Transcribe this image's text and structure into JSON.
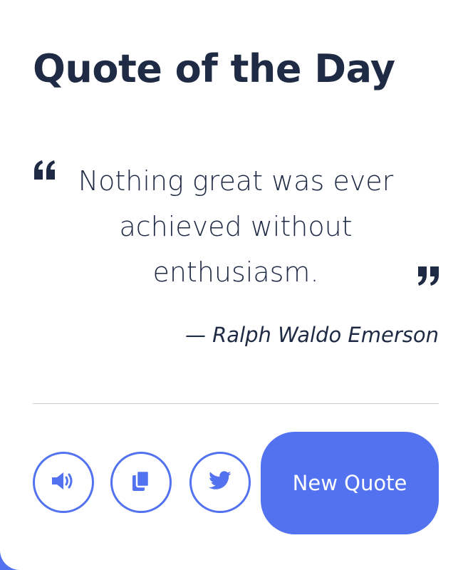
{
  "header": {
    "title": "Quote of the Day"
  },
  "quote": {
    "text": "Nothing great was ever achieved without enthusiasm.",
    "author": "— Ralph Waldo Emerson",
    "open_mark_icon": "quote-left-icon",
    "close_mark_icon": "quote-right-icon"
  },
  "actions": {
    "speech_icon": "volume-icon",
    "copy_icon": "copy-icon",
    "tweet_icon": "twitter-icon",
    "new_quote_label": "New Quote"
  },
  "colors": {
    "accent": "#5372f0",
    "text": "#1f2a44",
    "card": "#ffffff",
    "divider": "#cfcfd4"
  }
}
